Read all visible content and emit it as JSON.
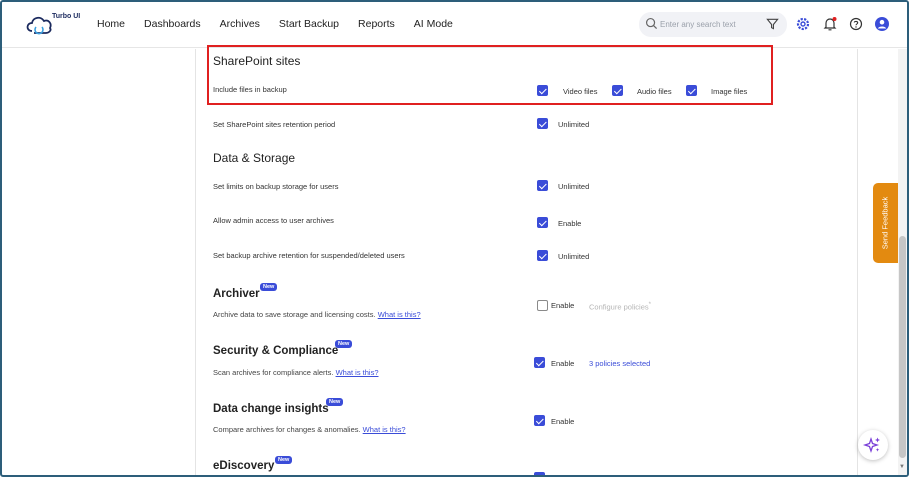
{
  "brand": {
    "name": "Turbo UI"
  },
  "nav": {
    "items": [
      "Home",
      "Dashboards",
      "Archives",
      "Start Backup",
      "Reports",
      "AI Mode"
    ]
  },
  "search": {
    "placeholder": "Enter any search text"
  },
  "sharepoint": {
    "title": "SharePoint sites",
    "include_label": "Include files in backup",
    "file_types": [
      {
        "label": "Video files",
        "checked": true
      },
      {
        "label": "Audio files",
        "checked": true
      },
      {
        "label": "Image files",
        "checked": true
      }
    ],
    "retention_label": "Set SharePoint sites retention period",
    "retention_value": "Unlimited"
  },
  "data_storage": {
    "title": "Data & Storage",
    "rows": [
      {
        "label": "Set limits on backup storage for users",
        "value": "Unlimited",
        "checked": true
      },
      {
        "label": "Allow admin access to user archives",
        "value": "Enable",
        "checked": true
      },
      {
        "label": "Set backup archive retention for suspended/deleted users",
        "value": "Unlimited",
        "checked": true
      }
    ]
  },
  "features": [
    {
      "title": "Archiver",
      "badge": "New",
      "desc": "Archive data to save storage and licensing costs.",
      "link": "What is this?",
      "toggle": "Enable",
      "checked": false,
      "extra": "Configure policies",
      "extra_mark": "*"
    },
    {
      "title": "Security & Compliance",
      "badge": "New",
      "desc": "Scan archives for compliance alerts.",
      "link": "What is this?",
      "toggle": "Enable",
      "checked": true,
      "extra": "3 policies selected"
    },
    {
      "title": "Data change insights",
      "badge": "New",
      "desc": "Compare archives for changes & anomalies.",
      "link": "What is this?",
      "toggle": "Enable",
      "checked": true
    },
    {
      "title": "eDiscovery",
      "badge": "New"
    }
  ],
  "feedback": {
    "label": "Send Feedback"
  },
  "colors": {
    "accent": "#3a4cd8",
    "highlight": "#e02020",
    "feedback": "#e38a10",
    "brand_dark": "#1b2a5e"
  },
  "icons": [
    "cloud-logo-icon",
    "search-icon",
    "filter-icon",
    "settings-icon",
    "notification-bell-icon",
    "help-icon",
    "user-avatar-icon",
    "ai-sparkle-icon"
  ]
}
